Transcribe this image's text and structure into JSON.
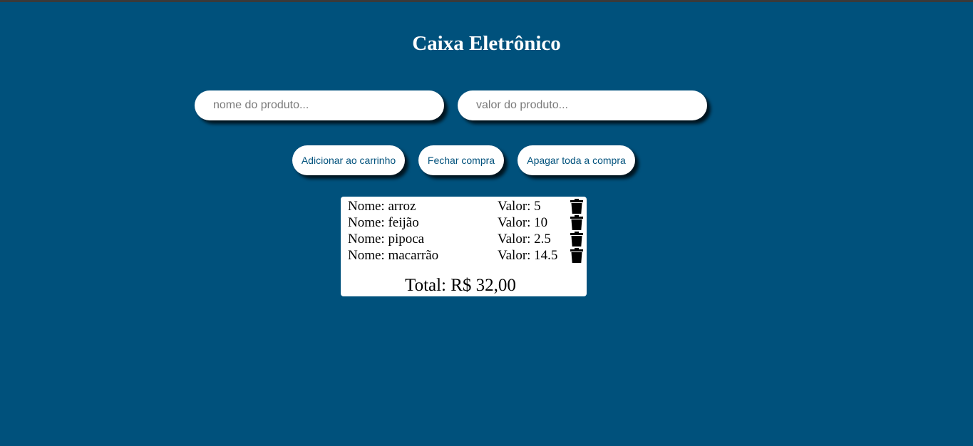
{
  "title": "Caixa Eletrônico",
  "inputs": {
    "nome_placeholder": "nome do produto...",
    "nome_value": "",
    "valor_placeholder": "valor do produto...",
    "valor_value": ""
  },
  "buttons": {
    "add": "Adicionar ao carrinho",
    "fechar": "Fechar compra",
    "apagar": "Apagar toda a compra"
  },
  "cart": {
    "items": [
      {
        "nome": "Nome: arroz",
        "valor": "Valor: 5"
      },
      {
        "nome": "Nome: feijão",
        "valor": "Valor: 10"
      },
      {
        "nome": "Nome: pipoca",
        "valor": "Valor: 2.5"
      },
      {
        "nome": "Nome: macarrão",
        "valor": "Valor: 14.5"
      }
    ],
    "total": "Total: R$ 32,00"
  },
  "colors": {
    "background": "#00517c",
    "button_text": "#00517c",
    "panel": "#ffffff"
  },
  "icons": {
    "delete": "trash-icon"
  }
}
